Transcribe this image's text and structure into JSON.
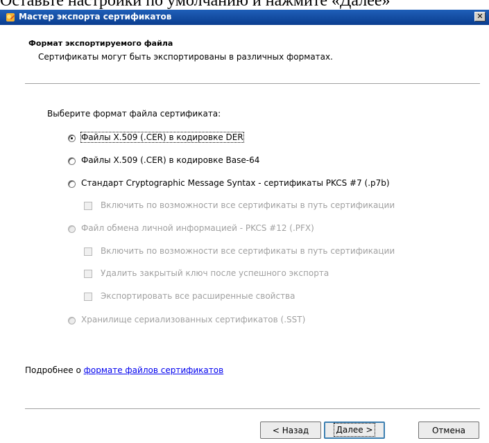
{
  "doc_fragment": "Оставьте настройки по умолчанию и нажмите «Далее»",
  "window": {
    "title": "Мастер экспорта сертификатов",
    "close_glyph": "✕"
  },
  "header": {
    "title": "Формат экспортируемого файла",
    "subtitle": "Сертификаты могут быть экспортированы в различных форматах."
  },
  "body": {
    "prompt": "Выберите формат файла сертификата:",
    "options": [
      {
        "label": "Файлы X.509 (.CER) в кодировке DER",
        "checked": true,
        "enabled": true
      },
      {
        "label": "Файлы X.509 (.CER) в кодировке Base-64",
        "checked": false,
        "enabled": true
      },
      {
        "label": "Стандарт Cryptographic Message Syntax - сертификаты PKCS #7 (.p7b)",
        "checked": false,
        "enabled": true
      },
      {
        "label": "Включить по возможности все сертификаты в путь сертификации",
        "checked": false,
        "enabled": false,
        "type": "checkbox"
      },
      {
        "label": "Файл обмена личной информацией - PKCS #12 (.PFX)",
        "checked": false,
        "enabled": false
      },
      {
        "label": "Включить по возможности все сертификаты в путь сертификации",
        "checked": false,
        "enabled": false,
        "type": "checkbox"
      },
      {
        "label": "Удалить закрытый ключ после успешного экспорта",
        "checked": false,
        "enabled": false,
        "type": "checkbox"
      },
      {
        "label": "Экспортировать все расширенные свойства",
        "checked": false,
        "enabled": false,
        "type": "checkbox"
      },
      {
        "label": "Хранилище сериализованных сертификатов (.SST)",
        "checked": false,
        "enabled": false
      }
    ],
    "more_prefix": "Подробнее о ",
    "more_link": "формате файлов сертификатов"
  },
  "footer": {
    "back_label": "< Назад",
    "next_label": "Далее >",
    "cancel_label": "Отмена"
  }
}
